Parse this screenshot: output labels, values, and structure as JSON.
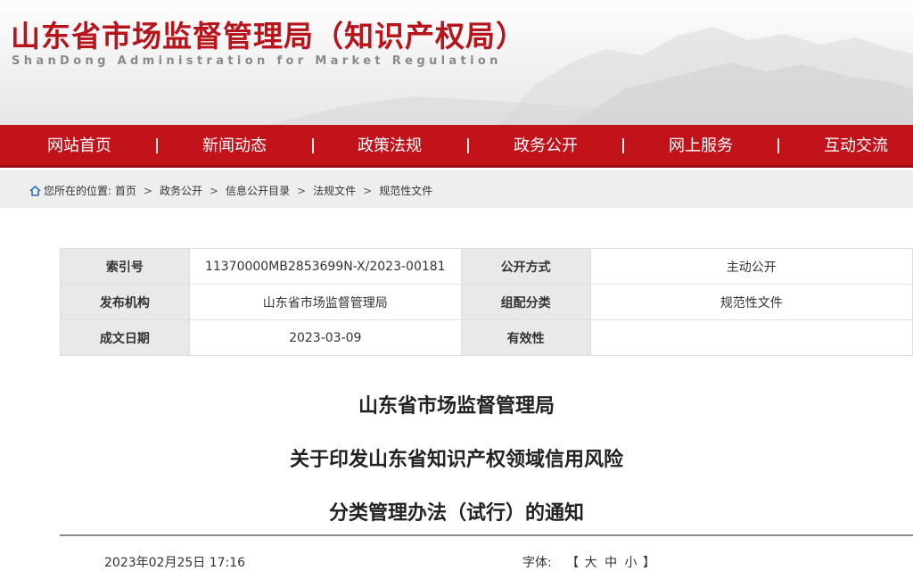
{
  "header": {
    "title": "山东省市场监督管理局（知识产权局）",
    "subtitle": "ShanDong Administration for Market Regulation"
  },
  "nav": {
    "items": [
      {
        "label": "网站首页"
      },
      {
        "label": "新闻动态"
      },
      {
        "label": "政策法规"
      },
      {
        "label": "政务公开"
      },
      {
        "label": "网上服务"
      },
      {
        "label": "互动交流"
      }
    ]
  },
  "breadcrumb": {
    "prefix": "您所在的位置:",
    "items": [
      "首页",
      "政务公开",
      "信息公开目录",
      "法规文件",
      "规范性文件"
    ],
    "separator": ">"
  },
  "meta": {
    "rows": [
      {
        "k1": "索引号",
        "v1": "11370000MB2853699N-X/2023-00181",
        "k2": "公开方式",
        "v2": "主动公开"
      },
      {
        "k1": "发布机构",
        "v1": "山东省市场监督管理局",
        "k2": "组配分类",
        "v2": "规范性文件"
      },
      {
        "k1": "成文日期",
        "v1": "2023-03-09",
        "k2": "有效性",
        "v2": ""
      }
    ]
  },
  "document": {
    "title_lines": [
      "山东省市场监督管理局",
      "关于印发山东省知识产权领域信用风险",
      "分类管理办法（试行）的通知"
    ],
    "publish_time": "2023年02月25日 17:16",
    "font_size_label": "字体:",
    "font_size_open": "【",
    "font_size_close": "】",
    "font_size_options": [
      "大",
      "中",
      "小"
    ]
  },
  "colors": {
    "brand_red": "#c2121a",
    "title_red": "#b8141c",
    "table_key_bg": "#e8e9eb"
  }
}
